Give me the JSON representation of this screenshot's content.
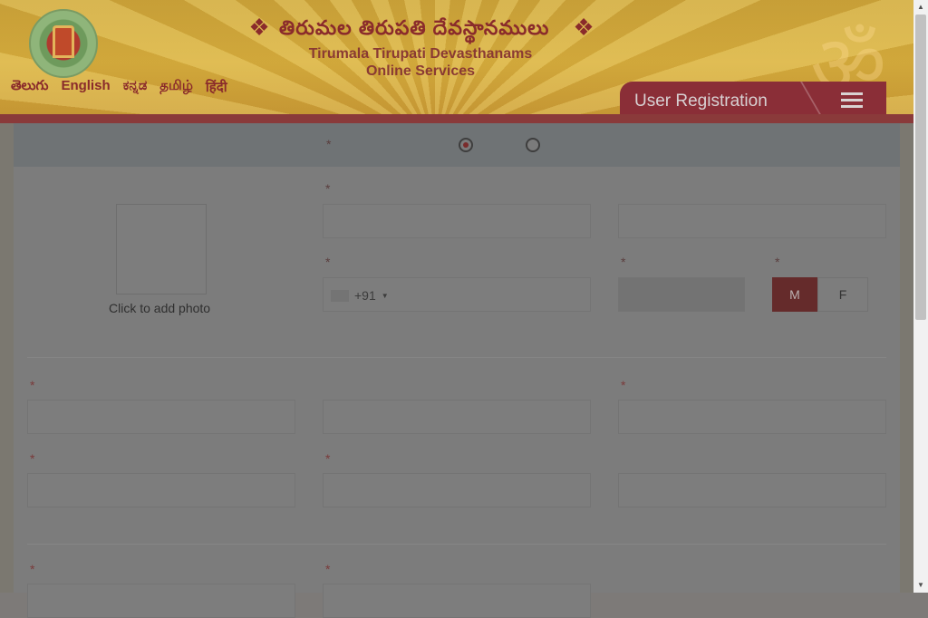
{
  "header": {
    "title_telugu": "తిరుమల తిరుపతి దేవస్థానములు",
    "title_english_line1": "Tirumala Tirupati Devasthanams",
    "title_english_line2": "Online Services",
    "languages": [
      "తెలుగు",
      "English",
      "ಕನ್ನಡ",
      "தமிழ்",
      "हिंदी"
    ],
    "section_title": "User Registration"
  },
  "form": {
    "required_marker": "*",
    "photo_label": "Click to add photo",
    "country_code": "+91",
    "gender_male": "M",
    "gender_female": "F"
  },
  "colors": {
    "header_gold": "#d4ad3e",
    "brand_red": "#8a2e37",
    "overlay_gray": "#7c7c7c"
  }
}
